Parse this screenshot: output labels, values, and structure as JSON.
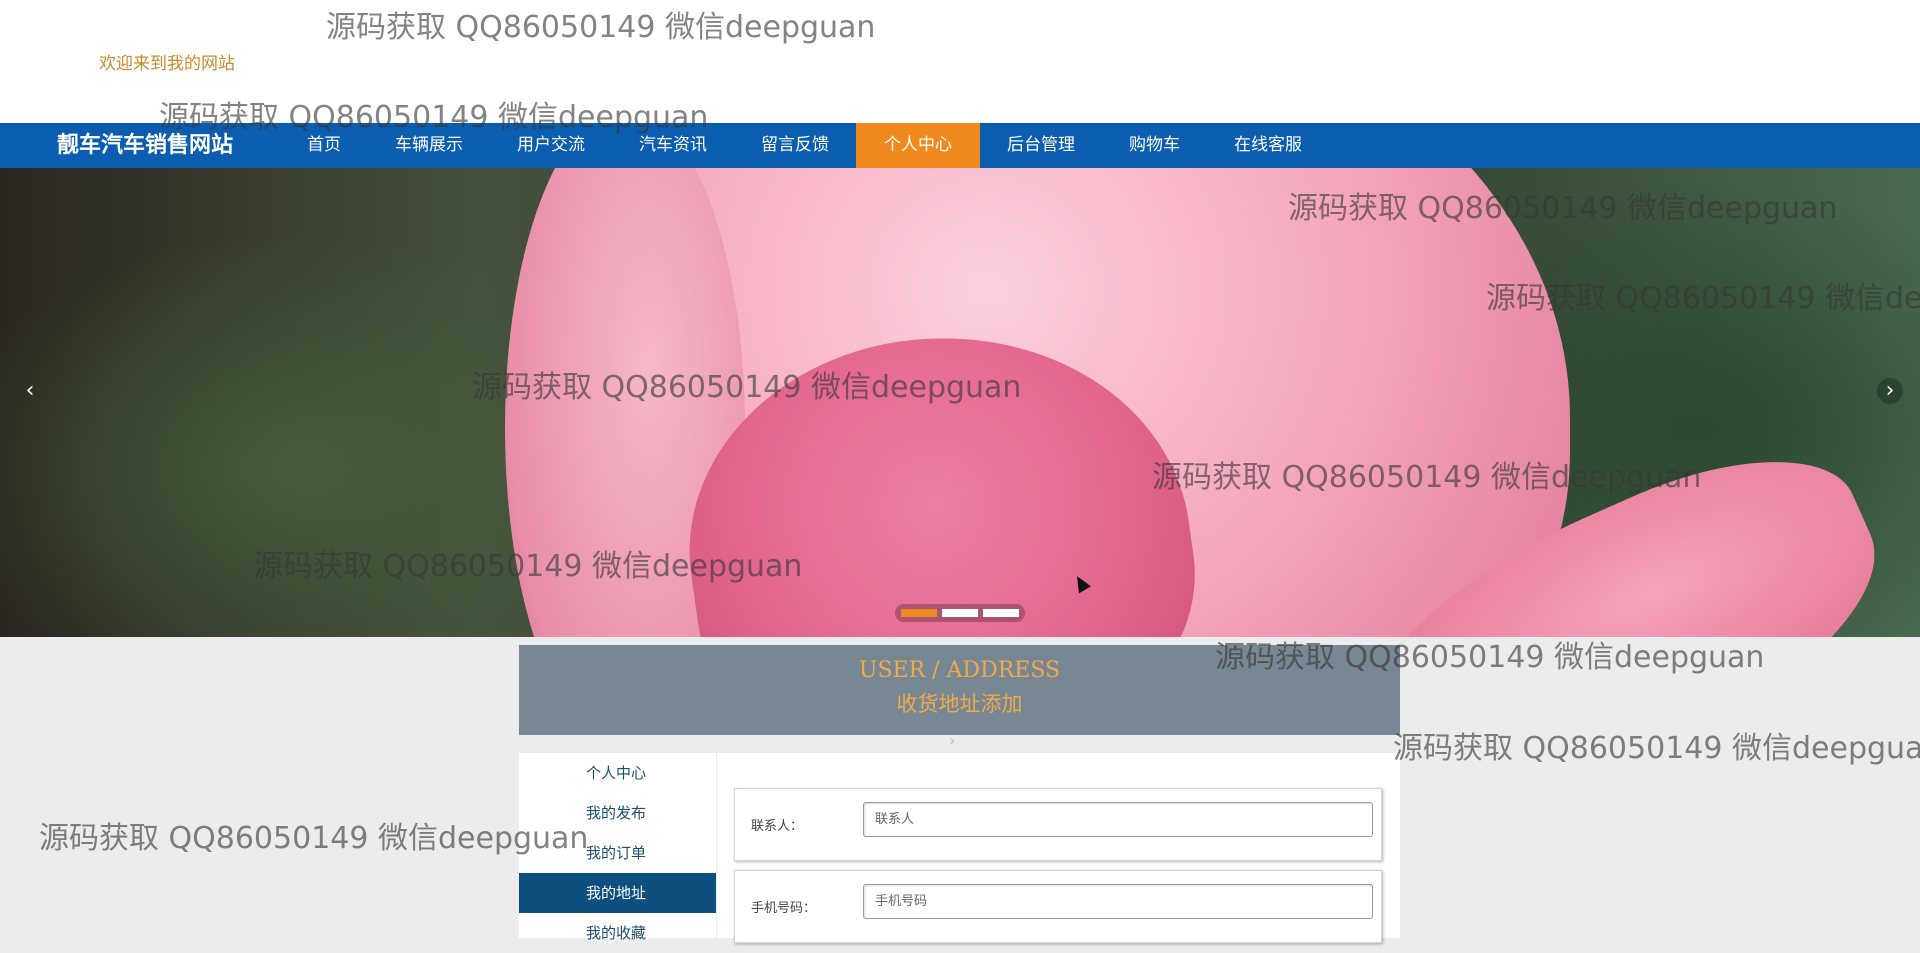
{
  "header": {
    "welcome": "欢迎来到我的网站"
  },
  "nav": {
    "site_title": "靓车汽车销售网站",
    "items": [
      {
        "label": "首页"
      },
      {
        "label": "车辆展示"
      },
      {
        "label": "用户交流"
      },
      {
        "label": "汽车资讯"
      },
      {
        "label": "留言反馈"
      },
      {
        "label": "个人中心",
        "active": true
      },
      {
        "label": "后台管理"
      },
      {
        "label": "购物车"
      },
      {
        "label": "在线客服"
      }
    ],
    "active_color": "#f08a1e",
    "bar_color": "#0b5db0"
  },
  "banner": {
    "prev_icon": "chevron-left-icon",
    "next_icon": "chevron-right-icon",
    "slide_count": 3,
    "active_slide": 1
  },
  "address_header": {
    "title_en": "USER / ADDRESS",
    "title_cn": "收货地址添加"
  },
  "side_menu": {
    "items": [
      {
        "label": "个人中心"
      },
      {
        "label": "我的发布"
      },
      {
        "label": "我的订单"
      },
      {
        "label": "我的地址",
        "active": true
      },
      {
        "label": "我的收藏"
      }
    ]
  },
  "form": {
    "contact": {
      "label": "联系人：",
      "placeholder": "联系人",
      "value": ""
    },
    "phone": {
      "label": "手机号码：",
      "placeholder": "手机号码",
      "value": ""
    }
  },
  "watermark": {
    "text": "源码获取 QQ86050149 微信deepguan"
  }
}
